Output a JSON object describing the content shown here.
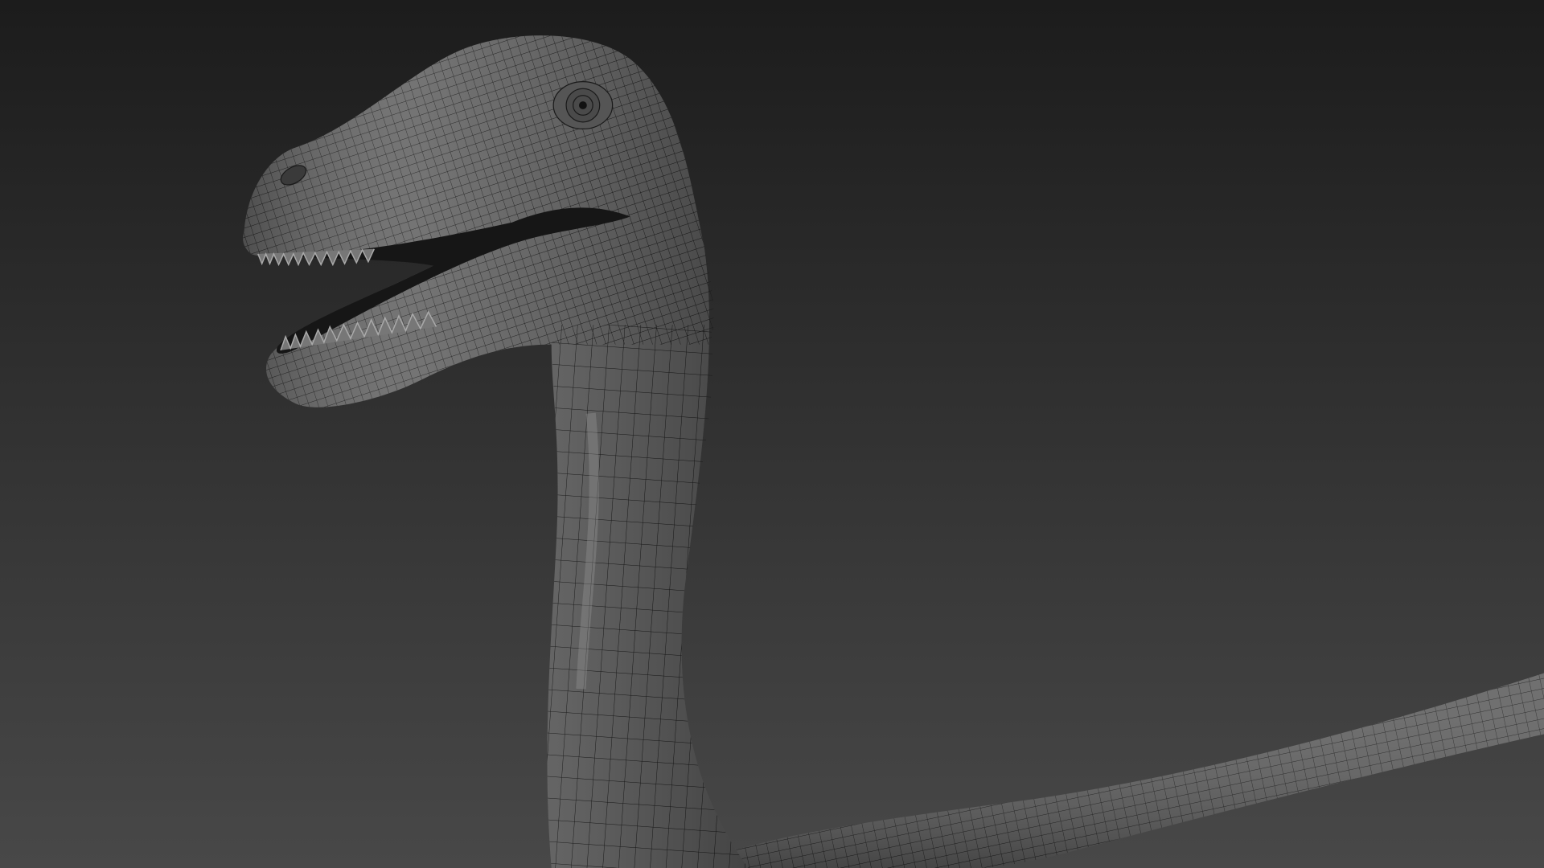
{
  "scene": {
    "subject": "dinosaur-wireframe-model",
    "colors": {
      "background_top": "#1c1c1c",
      "background_bottom": "#484848",
      "mesh_fill": "#666666",
      "mesh_shadow": "#3a3a3a",
      "wire": "#1a1a1a",
      "mouth": "#161616"
    }
  }
}
